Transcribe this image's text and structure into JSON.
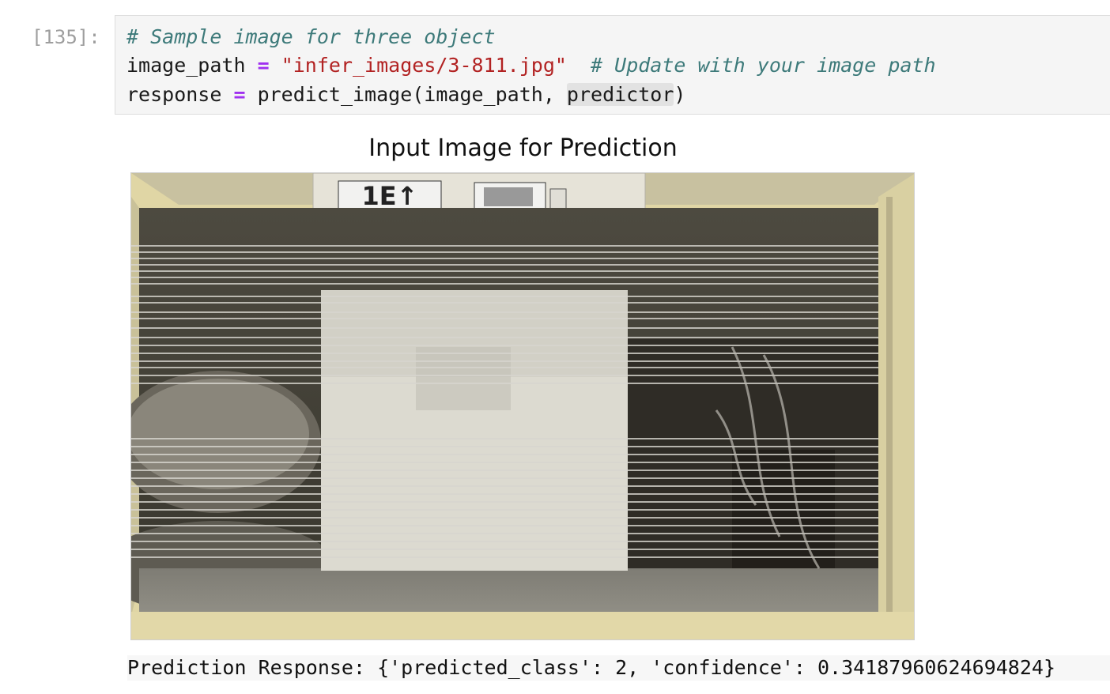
{
  "cell": {
    "prompt": "[135]:",
    "line1_comment": "# Sample image for three object",
    "line2_var": "image_path ",
    "line2_op": "=",
    "line2_str": "\"infer_images/3-811.jpg\"",
    "line2_comment": "# Update with your image path",
    "line3_var": "response ",
    "line3_op": "=",
    "line3_call": " predict_image(image_path, ",
    "line3_arg": "predictor",
    "line3_close": ")"
  },
  "figure": {
    "title": "Input Image for Prediction",
    "label_1": "1E↑"
  },
  "output": {
    "text": "Prediction Response: {'predicted_class': 2, 'confidence': 0.34187960624694824}"
  },
  "colors": {
    "comment": "#3d7a7a",
    "operator": "#a030f0",
    "string": "#b22222",
    "code_bg": "#f5f5f5"
  }
}
